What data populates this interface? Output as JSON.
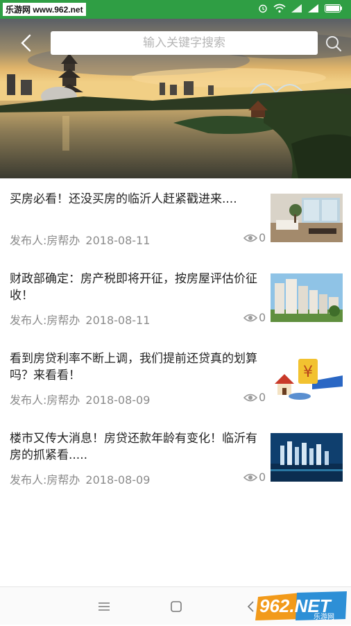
{
  "status_bar": {
    "watermark": "乐游网 www.962.net",
    "icons": [
      "alarm-icon",
      "wifi-icon",
      "signal-icon",
      "signal-icon",
      "battery-icon"
    ]
  },
  "header": {
    "search_placeholder": "输入关键字搜索",
    "back_icon": "chevron-left-icon",
    "search_icon": "search-icon"
  },
  "news": [
    {
      "title": "买房必看！还没买房的临沂人赶紧戳进来....",
      "publisher": "发布人:房帮办",
      "date": "2018-08-11",
      "views": "0",
      "thumb": "living-room"
    },
    {
      "title": "财政部确定：房产税即将开征，按房屋评估价征收！",
      "publisher": "发布人:房帮办",
      "date": "2018-08-11",
      "views": "0",
      "thumb": "apartment-buildings"
    },
    {
      "title": "看到房贷利率不断上调，我们提前还贷真的划算吗？来看看！",
      "publisher": "发布人:房帮办",
      "date": "2018-08-09",
      "views": "0",
      "thumb": "loan-cartoon"
    },
    {
      "title": "楼市又传大消息！房贷还款年龄有变化！临沂有房的抓紧看.....",
      "publisher": "发布人:房帮办",
      "date": "2018-08-09",
      "views": "0",
      "thumb": "city-night"
    }
  ],
  "nav_bar": {
    "icons": [
      "menu-icon",
      "home-square-icon",
      "back-triangle-icon"
    ]
  },
  "logo": {
    "text": "962.NET",
    "subtext": "乐游网"
  },
  "colors": {
    "status_green": "#2f9e44",
    "title_text": "#222222",
    "meta_text": "#8b8b8b"
  }
}
